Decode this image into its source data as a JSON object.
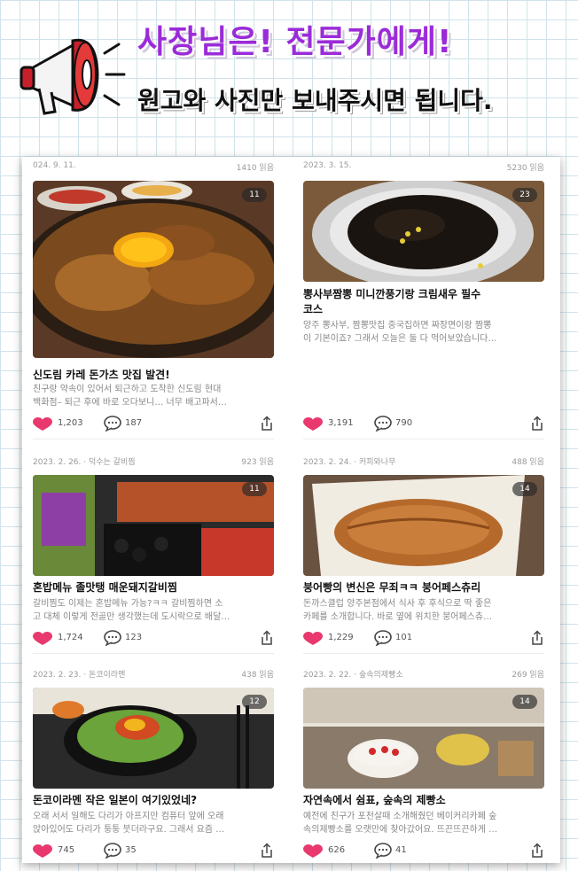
{
  "banner": {
    "headline": "사장님은! 전문가에게!",
    "subheadline": "원고와 사진만 보내주시면 됩니다."
  },
  "posts": [
    {
      "date": "024. 9. 11.",
      "views": "1410 읽음",
      "photo_count": "11",
      "title": "신도림 카레 돈가츠 맛집 발견!",
      "desc_line1": "친구랑 약속이 있어서 퇴근하고 도착한 신도림 현대",
      "desc_line2": "백화점– 퇴근 후에 바로 오다보니… 너무 배고파서…",
      "likes": "1,203",
      "comments": "187"
    },
    {
      "date": "2023. 3. 15.",
      "views": "5230 읽음",
      "photo_count": "23",
      "title_line1": "뽕사부짬뽕 미니깐풍기랑 크림새우 필수",
      "title_line2": "코스",
      "desc_line1": "양주 뽕사부, 짬뽕맛집 중국집하면 짜장면이랑 짬뽕",
      "desc_line2": "이 기본이죠? 그래서 오늘은 둘 다 먹어보았습니다…",
      "likes": "3,191",
      "comments": "790"
    },
    {
      "date": "2023. 2. 26. · 덕수는 갈비찜",
      "views": "923 읽음",
      "photo_count": "11",
      "title": "혼밥메뉴 졸맛탱 매운돼지갈비찜",
      "desc_line1": "갈비찜도 이제는 혼밥메뉴 가능?ㅋㅋ 갈비찜하면 소",
      "desc_line2": "고 대체 이렇게 전골만 생각했는데 도시락으로 배달…",
      "likes": "1,724",
      "comments": "123"
    },
    {
      "date": "2023. 2. 24. · 커피와나무",
      "views": "488 읽음",
      "photo_count": "14",
      "title": "붕어빵의 변신은 무죄ㅋㅋ 붕어페스츄리",
      "desc_line1": "돈까스클럽 양주본점에서 식사 후 후식으로 딱 좋은",
      "desc_line2": "카페를 소개합니다. 바로 옆에 위치한 붕어페스츄…",
      "likes": "1,229",
      "comments": "101"
    },
    {
      "date": "2023. 2. 23. · 돈코이라멘",
      "views": "438 읽음",
      "photo_count": "12",
      "title": "돈코이라멘 작은 일본이 여기있었네?",
      "desc_line1": "오래 서서 일해도 다리가 아프지만 컴퓨터 앞에 오래",
      "desc_line2": "앉아있어도 다리가 퉁퉁 붓더라구요. 그래서 요즘 …",
      "likes": "745",
      "comments": "35"
    },
    {
      "date": "2023. 2. 22. · 숲속의제빵소",
      "views": "269 읽음",
      "photo_count": "14",
      "title": "자연속에서 쉼표, 숲속의 제빵소",
      "desc_line1": "예전에 친구가 포천살때 소개해줬던 베이커리카페 숲",
      "desc_line2": "속의제빵소를 오랫만에 찾아갔어요. 뜨끈뜨끈하게 …",
      "likes": "626",
      "comments": "41"
    }
  ],
  "colors": {
    "heart": "#e8386d",
    "headline": "#9b2bd9",
    "megaphone_red": "#c8202a"
  }
}
